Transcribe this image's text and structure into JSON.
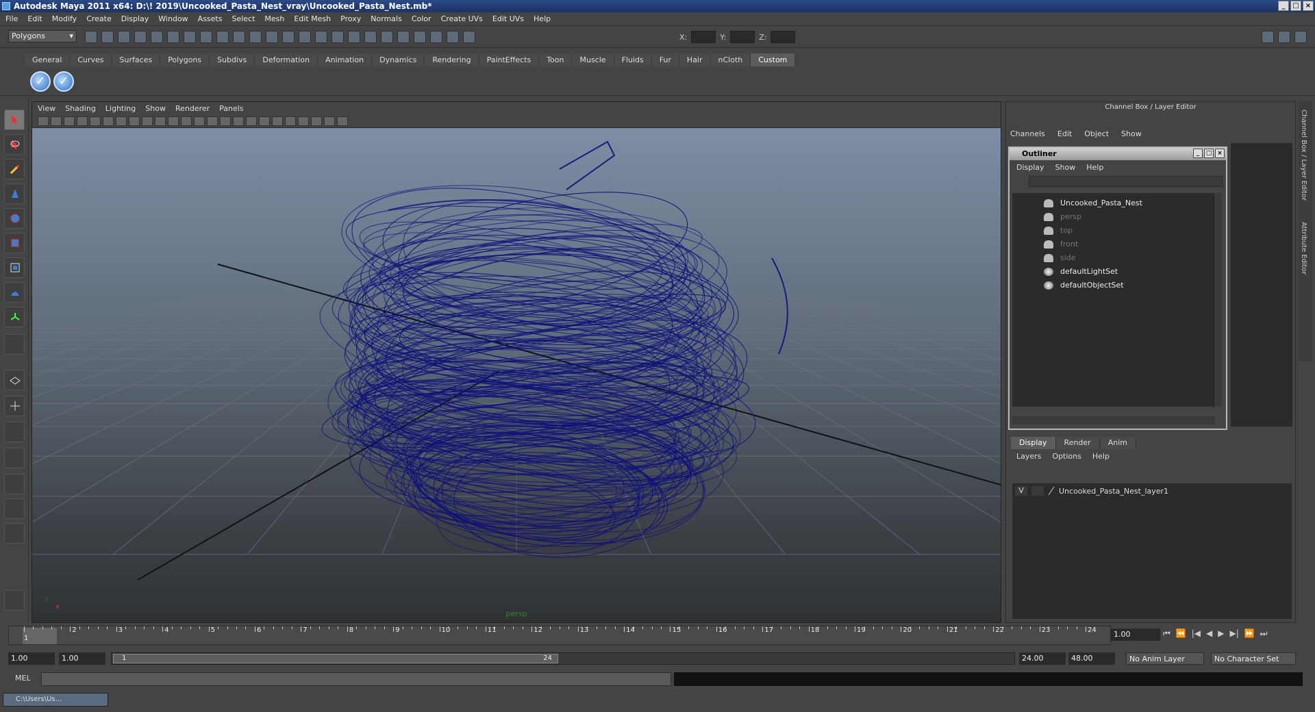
{
  "window": {
    "title": "Autodesk Maya 2011 x64: D:\\! 2019\\Uncooked_Pasta_Nest_vray\\Uncooked_Pasta_Nest.mb*"
  },
  "menubar": [
    "File",
    "Edit",
    "Modify",
    "Create",
    "Display",
    "Window",
    "Assets",
    "Select",
    "Mesh",
    "Edit Mesh",
    "Proxy",
    "Normals",
    "Color",
    "Create UVs",
    "Edit UVs",
    "Help"
  ],
  "statusline": {
    "mode": "Polygons",
    "x_label": "X:",
    "y_label": "Y:",
    "z_label": "Z:"
  },
  "shelf": {
    "tabs": [
      "General",
      "Curves",
      "Surfaces",
      "Polygons",
      "Subdivs",
      "Deformation",
      "Animation",
      "Dynamics",
      "Rendering",
      "PaintEffects",
      "Toon",
      "Muscle",
      "Fluids",
      "Fur",
      "Hair",
      "nCloth",
      "Custom"
    ],
    "active": "Custom"
  },
  "viewport": {
    "menu": [
      "View",
      "Shading",
      "Lighting",
      "Show",
      "Renderer",
      "Panels"
    ],
    "camera": "persp",
    "axis_y": "y",
    "axis_x": "x",
    "wire_color": "#10107a"
  },
  "channel_box": {
    "title": "Channel Box / Layer Editor",
    "menu": [
      "Channels",
      "Edit",
      "Object",
      "Show"
    ]
  },
  "outliner": {
    "title": "Outliner",
    "menu": [
      "Display",
      "Show",
      "Help"
    ],
    "items": [
      {
        "label": "Uncooked_Pasta_Nest",
        "state": "bright",
        "icon": "mesh-icon"
      },
      {
        "label": "persp",
        "state": "dim",
        "icon": "camera-icon"
      },
      {
        "label": "top",
        "state": "dim",
        "icon": "camera-icon"
      },
      {
        "label": "front",
        "state": "dim",
        "icon": "camera-icon"
      },
      {
        "label": "side",
        "state": "dim",
        "icon": "camera-icon"
      },
      {
        "label": "defaultLightSet",
        "state": "bright",
        "icon": "set-icon"
      },
      {
        "label": "defaultObjectSet",
        "state": "bright",
        "icon": "set-icon"
      }
    ]
  },
  "layer_editor": {
    "tabs": [
      "Display",
      "Render",
      "Anim"
    ],
    "active": "Display",
    "menu": [
      "Layers",
      "Options",
      "Help"
    ],
    "layers": [
      {
        "visible": "V",
        "name": "Uncooked_Pasta_Nest_layer1"
      }
    ]
  },
  "side_tabs": [
    "Channel Box / Layer Editor",
    "Attribute Editor"
  ],
  "timeline": {
    "frames": [
      "1",
      "2",
      "3",
      "4",
      "5",
      "6",
      "7",
      "8",
      "9",
      "10",
      "11",
      "12",
      "13",
      "14",
      "15",
      "16",
      "17",
      "18",
      "19",
      "20",
      "21",
      "22",
      "23",
      "24"
    ],
    "current_frame_label": "1",
    "current_time": "1.00"
  },
  "range": {
    "start_time": "1.00",
    "playback_start": "1.00",
    "range_start": "1",
    "range_end": "24",
    "playback_end": "24.00",
    "end_time": "48.00",
    "anim_layer": "No Anim Layer",
    "character_set": "No Character Set"
  },
  "command_line": {
    "label": "MEL"
  },
  "taskbar": {
    "item": "C:\\Users\\Us..."
  }
}
